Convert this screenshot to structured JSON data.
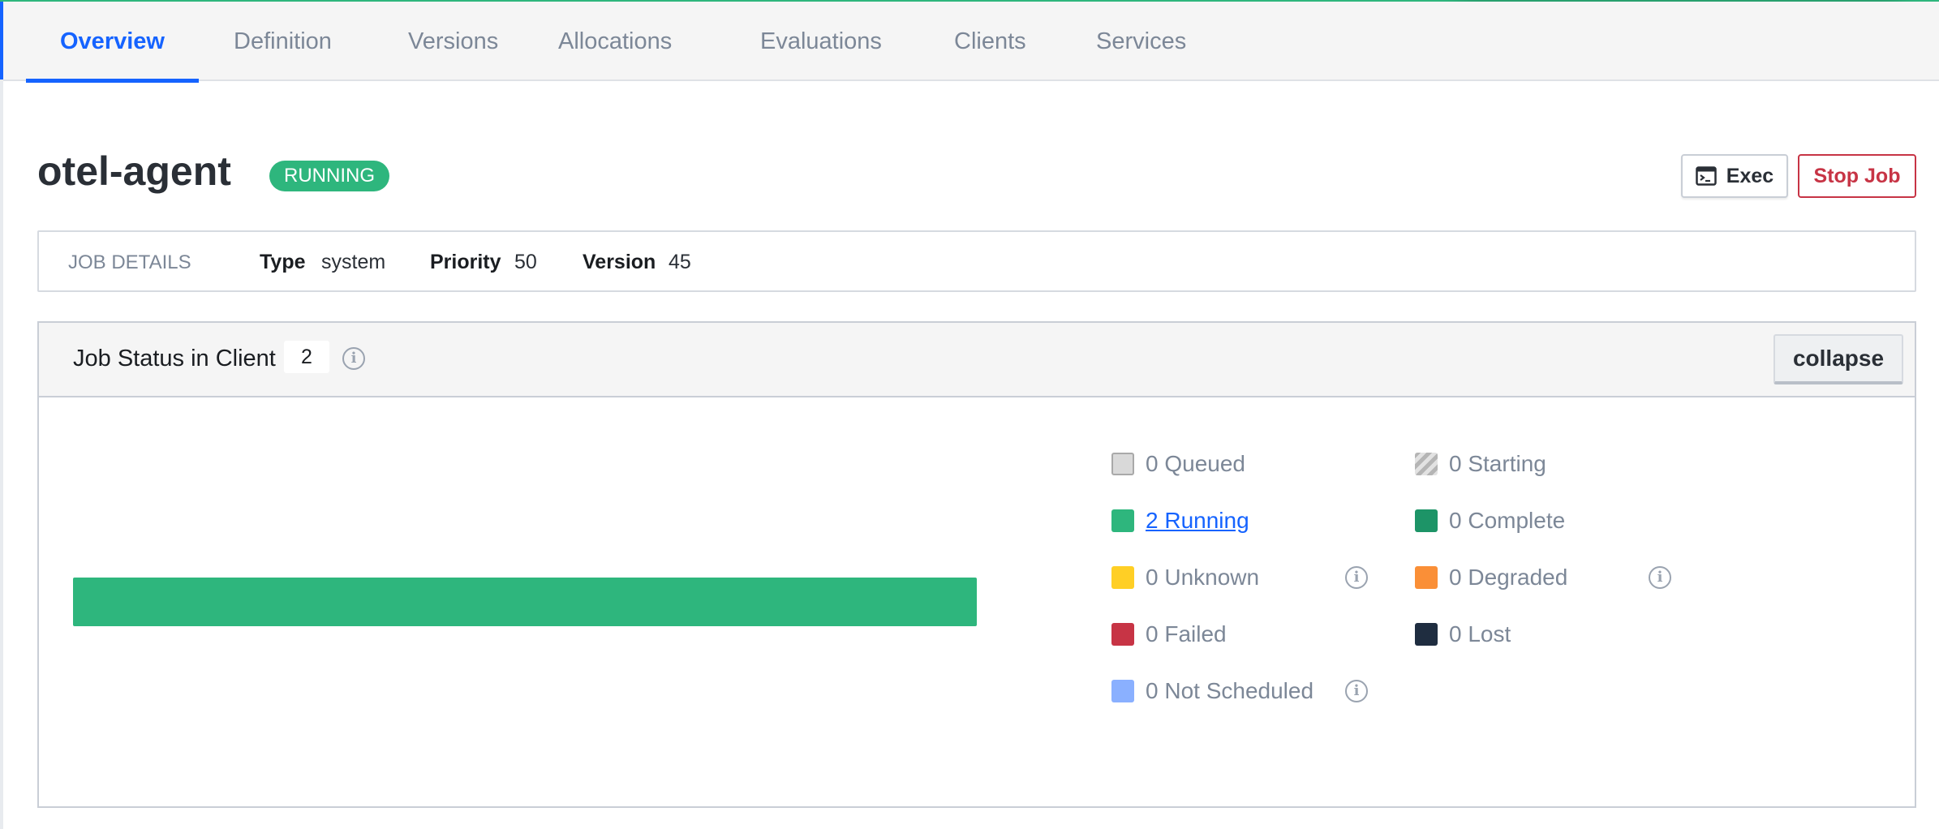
{
  "tabs": [
    {
      "label": "Overview",
      "active": true
    },
    {
      "label": "Definition",
      "active": false
    },
    {
      "label": "Versions",
      "active": false
    },
    {
      "label": "Allocations",
      "active": false
    },
    {
      "label": "Evaluations",
      "active": false
    },
    {
      "label": "Clients",
      "active": false
    },
    {
      "label": "Services",
      "active": false
    }
  ],
  "job": {
    "name": "otel-agent",
    "status": "RUNNING"
  },
  "actions": {
    "exec_label": "Exec",
    "stop_label": "Stop Job"
  },
  "details": {
    "section_label": "JOB DETAILS",
    "type_key": "Type",
    "type_value": "system",
    "priority_key": "Priority",
    "priority_value": "50",
    "version_key": "Version",
    "version_value": "45"
  },
  "job_status": {
    "title": "Job Status in Client",
    "client_count": "2",
    "collapse_label": "collapse",
    "running_fraction": 1.0,
    "legend": [
      {
        "label": "0 Queued",
        "color": "#d9d9d9",
        "info": false,
        "link": false
      },
      {
        "label": "0 Starting",
        "color": "striped",
        "info": false,
        "link": false
      },
      {
        "label": "2 Running",
        "color": "#2eb67d",
        "info": false,
        "link": true
      },
      {
        "label": "0 Complete",
        "color": "#1d9467",
        "info": false,
        "link": false
      },
      {
        "label": "0 Unknown",
        "color": "#ffcf25",
        "info": true,
        "link": false
      },
      {
        "label": "0 Degraded",
        "color": "#fa8f37",
        "info": true,
        "link": false
      },
      {
        "label": "0 Failed",
        "color": "#c73445",
        "info": false,
        "link": false
      },
      {
        "label": "0 Lost",
        "color": "#1f2d40",
        "info": false,
        "link": false
      },
      {
        "label": "0 Not Scheduled",
        "color": "#8ab0ff",
        "info": true,
        "link": false
      }
    ]
  }
}
